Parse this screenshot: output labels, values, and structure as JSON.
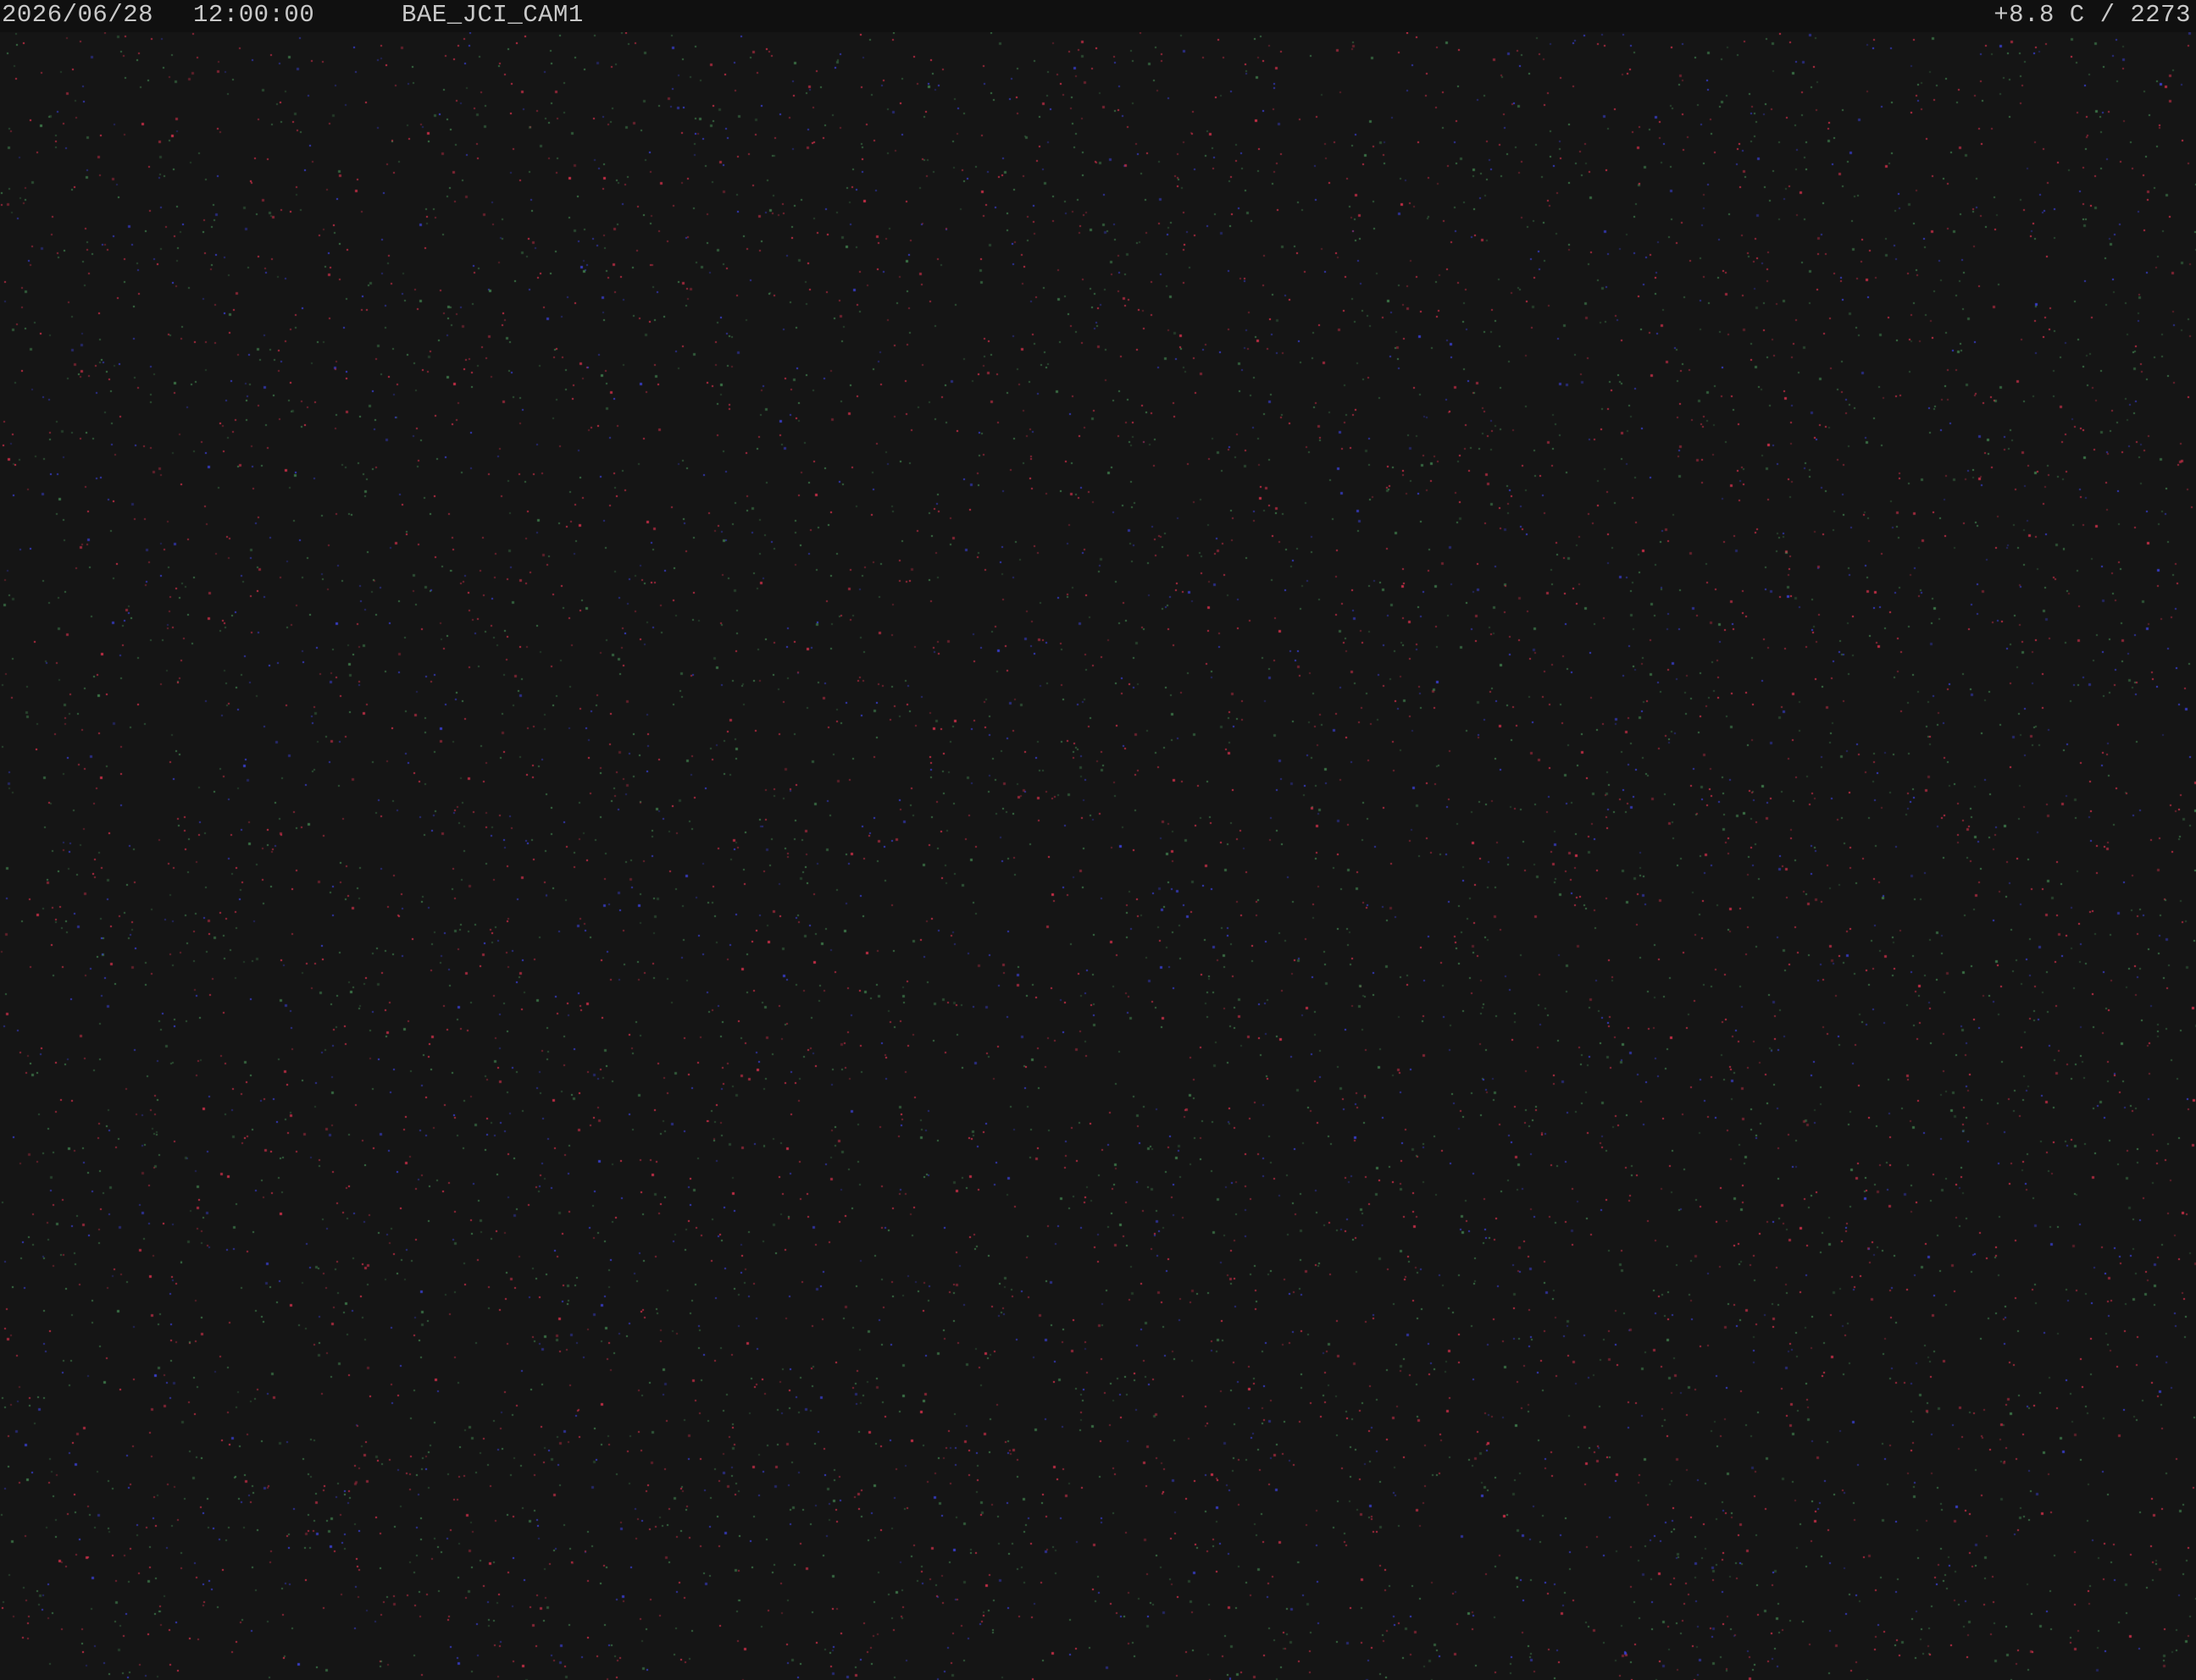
{
  "overlay": {
    "date": "2026/06/28",
    "time": "12:00:00",
    "camera_id": "BAE_JCI_CAM1",
    "sensor_readout": "+8.8 C / 2273"
  },
  "image": {
    "description_colors": {
      "background": "#151515",
      "overlay_bar": "#101010",
      "overlay_text": "#c9c9c9",
      "noise_red": "#d0304a",
      "noise_green": "#3e7a4a",
      "noise_blue": "#3a3fd0"
    }
  }
}
